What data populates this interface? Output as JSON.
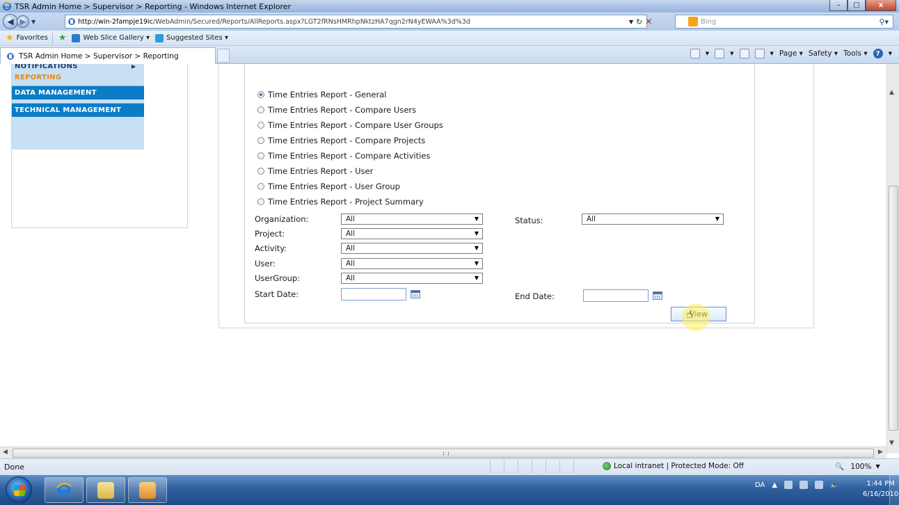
{
  "window": {
    "title": "TSR Admin Home > Supervisor > Reporting - Windows Internet Explorer",
    "minimize": "–",
    "maximize": "□",
    "close": "x"
  },
  "address": {
    "url_host": "http://win-2fampje19ic",
    "url_path": "/WebAdmin/Secured/Reports/AllReports.aspx?LGT2fRNsHMRhpNktzHA7qgn2rN4yEWAA%3d%3d",
    "search_placeholder": "Bing"
  },
  "favorites": {
    "favorites_label": "Favorites",
    "web_slice_label": "Web Slice Gallery ▾",
    "suggested_label": "Suggested Sites ▾"
  },
  "tab": {
    "title": "TSR Admin Home > Supervisor > Reporting"
  },
  "commands": [
    "Page ▾",
    "Safety ▾",
    "Tools ▾"
  ],
  "nav_menu": {
    "notifications": "NOTIFICATIONS",
    "reporting": "REPORTING",
    "data_management": "DATA MANAGEMENT",
    "technical_management": "TECHNICAL MANAGEMENT"
  },
  "reports": [
    {
      "label": "Time Entries Report - General",
      "checked": true
    },
    {
      "label": "Time Entries Report - Compare Users",
      "checked": false
    },
    {
      "label": "Time Entries Report - Compare User Groups",
      "checked": false
    },
    {
      "label": "Time Entries Report - Compare Projects",
      "checked": false
    },
    {
      "label": "Time Entries Report - Compare Activities",
      "checked": false
    },
    {
      "label": "Time Entries Report - User",
      "checked": false
    },
    {
      "label": "Time Entries Report - User Group",
      "checked": false
    },
    {
      "label": "Time Entries Report - Project Summary",
      "checked": false
    }
  ],
  "filters": {
    "organization_label": "Organization:",
    "organization_value": "All",
    "project_label": "Project:",
    "project_value": "All",
    "activity_label": "Activity:",
    "activity_value": "All",
    "user_label": "User:",
    "user_value": "All",
    "usergroup_label": "UserGroup:",
    "usergroup_value": "All",
    "status_label": "Status:",
    "status_value": "All",
    "start_date_label": "Start Date:",
    "end_date_label": "End Date:",
    "start_date_value": "",
    "end_date_value": "",
    "view_button": "View"
  },
  "status": {
    "text": "Done",
    "zone": "Local intranet | Protected Mode: Off",
    "zoom": " 100%"
  },
  "taskbar": {
    "language": "DA",
    "time": "1:44 PM",
    "date": "6/16/2010"
  },
  "colors": {
    "menu_bg": "#c7e0f4",
    "menu_active": "#e0891a",
    "menu_item_bg": "#0c7cc6"
  }
}
